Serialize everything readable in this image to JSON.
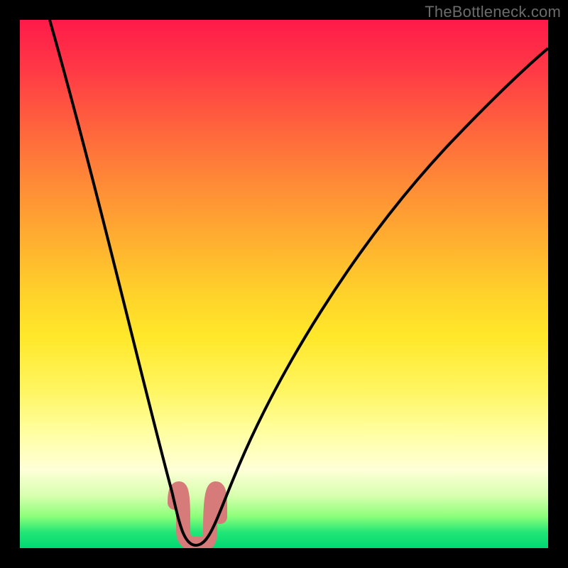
{
  "watermark": "TheBottleneck.com",
  "chart_data": {
    "type": "line",
    "title": "",
    "xlabel": "",
    "ylabel": "",
    "xlim": [
      0,
      100
    ],
    "ylim": [
      0,
      100
    ],
    "background_gradient": {
      "top_color": "#ff1a4a",
      "bottom_color": "#00d873",
      "meaning": "bottleneck severity (red=high, green=low)"
    },
    "series": [
      {
        "name": "bottleneck-curve",
        "x": [
          5,
          10,
          15,
          18,
          22,
          26,
          29,
          31,
          33,
          35,
          38,
          42,
          48,
          55,
          63,
          72,
          82,
          92,
          100
        ],
        "values": [
          100,
          80,
          60,
          48,
          33,
          18,
          8,
          2,
          0,
          0,
          3,
          10,
          22,
          35,
          48,
          60,
          70,
          78,
          83
        ]
      }
    ],
    "highlight": {
      "name": "optimal-range",
      "color": "#d77a7a",
      "xrange": [
        29,
        35
      ],
      "yrange": [
        0,
        8
      ]
    }
  }
}
